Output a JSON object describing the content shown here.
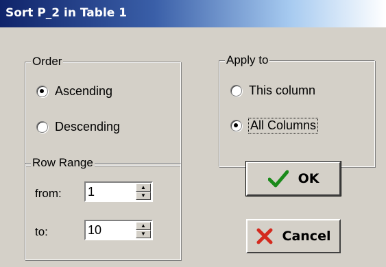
{
  "window": {
    "title": "Sort P_2 in Table 1"
  },
  "order": {
    "legend": "Order",
    "options": [
      {
        "label": "Ascending",
        "checked": true
      },
      {
        "label": "Descending",
        "checked": false
      }
    ]
  },
  "apply_to": {
    "legend": "Apply to",
    "options": [
      {
        "label": "This column",
        "checked": false
      },
      {
        "label": "All Columns",
        "checked": true
      }
    ]
  },
  "row_range": {
    "legend": "Row Range",
    "from_label": "from:",
    "from_value": "1",
    "to_label": "to:",
    "to_value": "10"
  },
  "buttons": {
    "ok": {
      "label": "OK",
      "icon": "checkmark-icon",
      "color": "#1a8a1a"
    },
    "cancel": {
      "label": "Cancel",
      "icon": "red-x-icon",
      "color": "#d42a1e"
    }
  }
}
